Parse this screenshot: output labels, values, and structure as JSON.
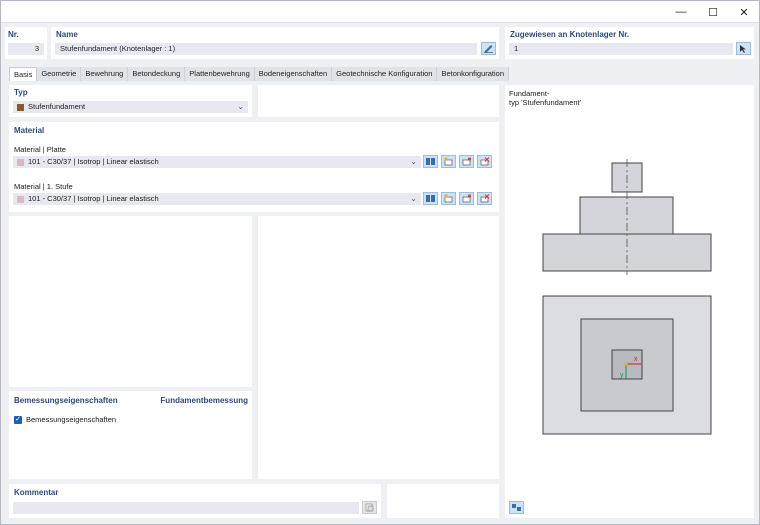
{
  "window": {
    "min_icon": "minimize-icon",
    "max_icon": "maximize-icon",
    "close_icon": "close-icon",
    "min_glyph": "—",
    "max_glyph": "☐",
    "close_glyph": "✕"
  },
  "header": {
    "nr_label": "Nr.",
    "nr_value": "3",
    "name_label": "Name",
    "name_value": "Stufenfundament (Knotenlager : 1)",
    "assigned_label": "Zugewiesen an Knotenlager Nr.",
    "assigned_value": "1"
  },
  "tabs": [
    "Basis",
    "Geometrie",
    "Bewehrung",
    "Betondeckung",
    "Plattenbewehrung",
    "Bodeneigenschaften",
    "Geotechnische Konfiguration",
    "Betonkonfiguration"
  ],
  "typ": {
    "label": "Typ",
    "value": "Stufenfundament",
    "swatch_color": "#8b5a2b"
  },
  "material": {
    "label": "Material",
    "platte_label": "Material | Platte",
    "platte_value": "101 - C30/37 | Isotrop | Linear elastisch",
    "stufe_label": "Material | 1. Stufe",
    "stufe_value": "101 - C30/37 | Isotrop | Linear elastisch",
    "swatch_color": "#d9b9c4"
  },
  "design": {
    "label": "Bemessungseigenschaften",
    "right_label": "Fundamentbemessung",
    "checkbox_label": "Bemessungseigenschaften",
    "checked": true
  },
  "comment": {
    "label": "Kommentar",
    "value": ""
  },
  "preview": {
    "title_line1": "Fundament-",
    "title_line2": "typ 'Stufenfundament'",
    "axis_x": "x",
    "axis_y": "y"
  }
}
